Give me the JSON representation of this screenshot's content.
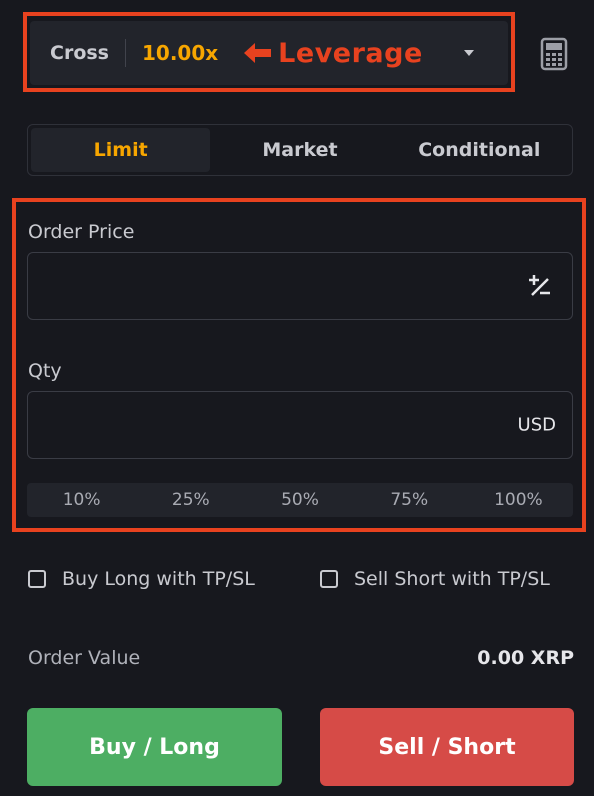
{
  "leverage": {
    "mode": "Cross",
    "value": "10.00x",
    "annotation": "Leverage",
    "dropdown_icon": "chevron-down-icon",
    "calculator_icon": "calculator-icon"
  },
  "order_tabs": [
    {
      "label": "Limit",
      "active": true
    },
    {
      "label": "Market",
      "active": false
    },
    {
      "label": "Conditional",
      "active": false
    }
  ],
  "order_price": {
    "label": "Order Price",
    "value": "",
    "icon": "plus-minus-icon"
  },
  "qty": {
    "label": "Qty",
    "value": "",
    "unit": "USD"
  },
  "percentages": [
    "10%",
    "25%",
    "50%",
    "75%",
    "100%"
  ],
  "tpsl": {
    "buy_long": {
      "label": "Buy Long with TP/SL",
      "checked": false
    },
    "sell_short": {
      "label": "Sell Short with TP/SL",
      "checked": false
    }
  },
  "order_value": {
    "label": "Order Value",
    "value": "0.00 XRP"
  },
  "actions": {
    "buy_label": "Buy / Long",
    "sell_label": "Sell / Short"
  },
  "colors": {
    "accent": "#f7a600",
    "annotation": "#e8421f",
    "buy": "#4dae63",
    "sell": "#d64b47",
    "background": "#17181e"
  }
}
